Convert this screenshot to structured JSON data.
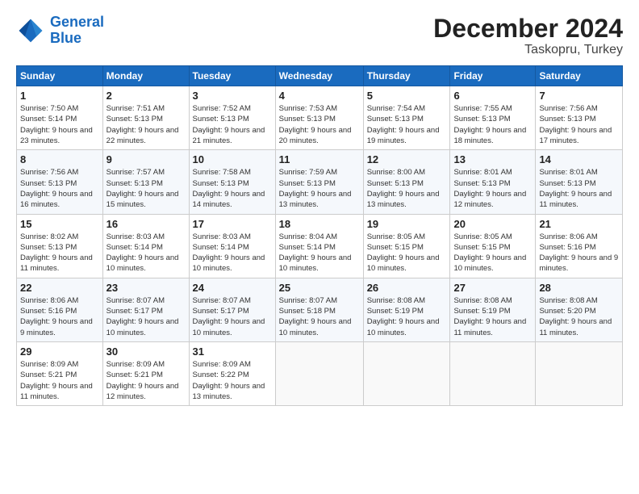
{
  "header": {
    "logo_line1": "General",
    "logo_line2": "Blue",
    "month": "December 2024",
    "location": "Taskopru, Turkey"
  },
  "days_of_week": [
    "Sunday",
    "Monday",
    "Tuesday",
    "Wednesday",
    "Thursday",
    "Friday",
    "Saturday"
  ],
  "weeks": [
    [
      {
        "day": "1",
        "sunrise": "Sunrise: 7:50 AM",
        "sunset": "Sunset: 5:14 PM",
        "daylight": "Daylight: 9 hours and 23 minutes."
      },
      {
        "day": "2",
        "sunrise": "Sunrise: 7:51 AM",
        "sunset": "Sunset: 5:13 PM",
        "daylight": "Daylight: 9 hours and 22 minutes."
      },
      {
        "day": "3",
        "sunrise": "Sunrise: 7:52 AM",
        "sunset": "Sunset: 5:13 PM",
        "daylight": "Daylight: 9 hours and 21 minutes."
      },
      {
        "day": "4",
        "sunrise": "Sunrise: 7:53 AM",
        "sunset": "Sunset: 5:13 PM",
        "daylight": "Daylight: 9 hours and 20 minutes."
      },
      {
        "day": "5",
        "sunrise": "Sunrise: 7:54 AM",
        "sunset": "Sunset: 5:13 PM",
        "daylight": "Daylight: 9 hours and 19 minutes."
      },
      {
        "day": "6",
        "sunrise": "Sunrise: 7:55 AM",
        "sunset": "Sunset: 5:13 PM",
        "daylight": "Daylight: 9 hours and 18 minutes."
      },
      {
        "day": "7",
        "sunrise": "Sunrise: 7:56 AM",
        "sunset": "Sunset: 5:13 PM",
        "daylight": "Daylight: 9 hours and 17 minutes."
      }
    ],
    [
      {
        "day": "8",
        "sunrise": "Sunrise: 7:56 AM",
        "sunset": "Sunset: 5:13 PM",
        "daylight": "Daylight: 9 hours and 16 minutes."
      },
      {
        "day": "9",
        "sunrise": "Sunrise: 7:57 AM",
        "sunset": "Sunset: 5:13 PM",
        "daylight": "Daylight: 9 hours and 15 minutes."
      },
      {
        "day": "10",
        "sunrise": "Sunrise: 7:58 AM",
        "sunset": "Sunset: 5:13 PM",
        "daylight": "Daylight: 9 hours and 14 minutes."
      },
      {
        "day": "11",
        "sunrise": "Sunrise: 7:59 AM",
        "sunset": "Sunset: 5:13 PM",
        "daylight": "Daylight: 9 hours and 13 minutes."
      },
      {
        "day": "12",
        "sunrise": "Sunrise: 8:00 AM",
        "sunset": "Sunset: 5:13 PM",
        "daylight": "Daylight: 9 hours and 13 minutes."
      },
      {
        "day": "13",
        "sunrise": "Sunrise: 8:01 AM",
        "sunset": "Sunset: 5:13 PM",
        "daylight": "Daylight: 9 hours and 12 minutes."
      },
      {
        "day": "14",
        "sunrise": "Sunrise: 8:01 AM",
        "sunset": "Sunset: 5:13 PM",
        "daylight": "Daylight: 9 hours and 11 minutes."
      }
    ],
    [
      {
        "day": "15",
        "sunrise": "Sunrise: 8:02 AM",
        "sunset": "Sunset: 5:13 PM",
        "daylight": "Daylight: 9 hours and 11 minutes."
      },
      {
        "day": "16",
        "sunrise": "Sunrise: 8:03 AM",
        "sunset": "Sunset: 5:14 PM",
        "daylight": "Daylight: 9 hours and 10 minutes."
      },
      {
        "day": "17",
        "sunrise": "Sunrise: 8:03 AM",
        "sunset": "Sunset: 5:14 PM",
        "daylight": "Daylight: 9 hours and 10 minutes."
      },
      {
        "day": "18",
        "sunrise": "Sunrise: 8:04 AM",
        "sunset": "Sunset: 5:14 PM",
        "daylight": "Daylight: 9 hours and 10 minutes."
      },
      {
        "day": "19",
        "sunrise": "Sunrise: 8:05 AM",
        "sunset": "Sunset: 5:15 PM",
        "daylight": "Daylight: 9 hours and 10 minutes."
      },
      {
        "day": "20",
        "sunrise": "Sunrise: 8:05 AM",
        "sunset": "Sunset: 5:15 PM",
        "daylight": "Daylight: 9 hours and 10 minutes."
      },
      {
        "day": "21",
        "sunrise": "Sunrise: 8:06 AM",
        "sunset": "Sunset: 5:16 PM",
        "daylight": "Daylight: 9 hours and 9 minutes."
      }
    ],
    [
      {
        "day": "22",
        "sunrise": "Sunrise: 8:06 AM",
        "sunset": "Sunset: 5:16 PM",
        "daylight": "Daylight: 9 hours and 9 minutes."
      },
      {
        "day": "23",
        "sunrise": "Sunrise: 8:07 AM",
        "sunset": "Sunset: 5:17 PM",
        "daylight": "Daylight: 9 hours and 10 minutes."
      },
      {
        "day": "24",
        "sunrise": "Sunrise: 8:07 AM",
        "sunset": "Sunset: 5:17 PM",
        "daylight": "Daylight: 9 hours and 10 minutes."
      },
      {
        "day": "25",
        "sunrise": "Sunrise: 8:07 AM",
        "sunset": "Sunset: 5:18 PM",
        "daylight": "Daylight: 9 hours and 10 minutes."
      },
      {
        "day": "26",
        "sunrise": "Sunrise: 8:08 AM",
        "sunset": "Sunset: 5:19 PM",
        "daylight": "Daylight: 9 hours and 10 minutes."
      },
      {
        "day": "27",
        "sunrise": "Sunrise: 8:08 AM",
        "sunset": "Sunset: 5:19 PM",
        "daylight": "Daylight: 9 hours and 11 minutes."
      },
      {
        "day": "28",
        "sunrise": "Sunrise: 8:08 AM",
        "sunset": "Sunset: 5:20 PM",
        "daylight": "Daylight: 9 hours and 11 minutes."
      }
    ],
    [
      {
        "day": "29",
        "sunrise": "Sunrise: 8:09 AM",
        "sunset": "Sunset: 5:21 PM",
        "daylight": "Daylight: 9 hours and 11 minutes."
      },
      {
        "day": "30",
        "sunrise": "Sunrise: 8:09 AM",
        "sunset": "Sunset: 5:21 PM",
        "daylight": "Daylight: 9 hours and 12 minutes."
      },
      {
        "day": "31",
        "sunrise": "Sunrise: 8:09 AM",
        "sunset": "Sunset: 5:22 PM",
        "daylight": "Daylight: 9 hours and 13 minutes."
      },
      null,
      null,
      null,
      null
    ]
  ]
}
